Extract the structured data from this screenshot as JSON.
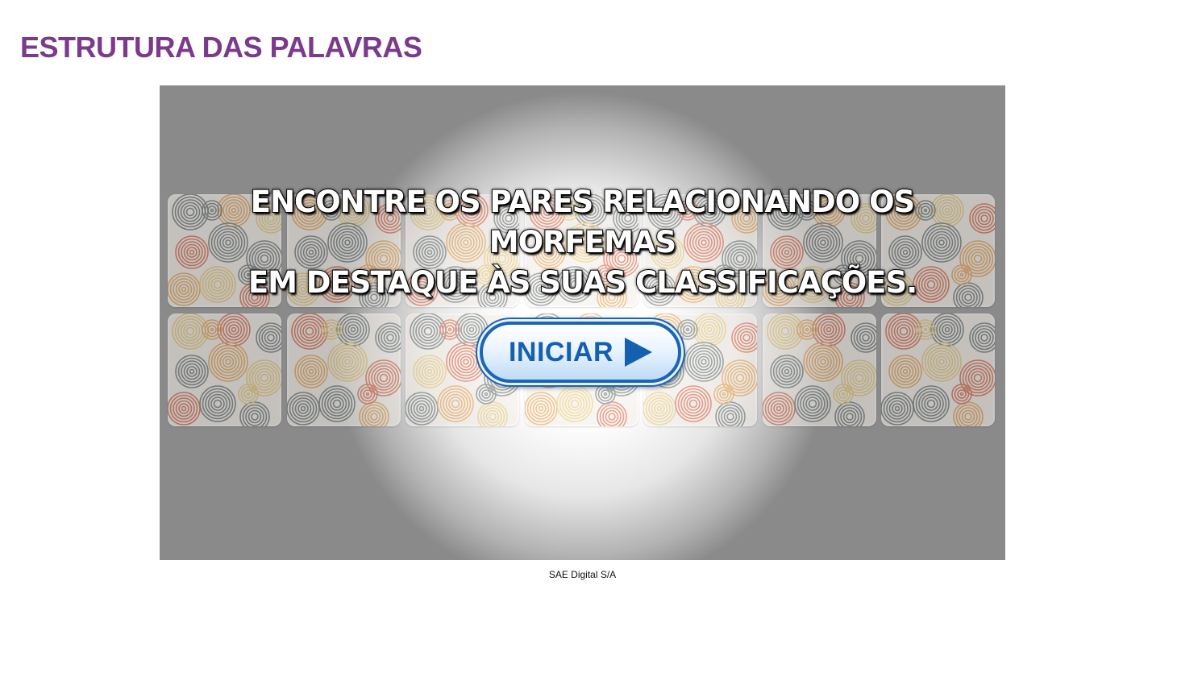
{
  "page": {
    "title": "ESTRUTURA DAS PALAVRAS",
    "footer": "SAE Digital S/A"
  },
  "game": {
    "instruction_line1": "ENCONTRE OS PARES RELACIONANDO OS MORFEMAS",
    "instruction_line2": "EM DESTAQUE ÀS SUAS CLASSIFICAÇÕES.",
    "start_label": "INICIAR",
    "start_icon": "play-arrow-icon",
    "card_rows": 2,
    "card_columns": 7
  },
  "colors": {
    "title": "#7b3a8c",
    "button_blue": "#1460b0",
    "swirl_gray": "#5f6b6b",
    "swirl_orange": "#e69a40",
    "swirl_yellow": "#e8c56a",
    "swirl_red": "#d85a3a"
  }
}
